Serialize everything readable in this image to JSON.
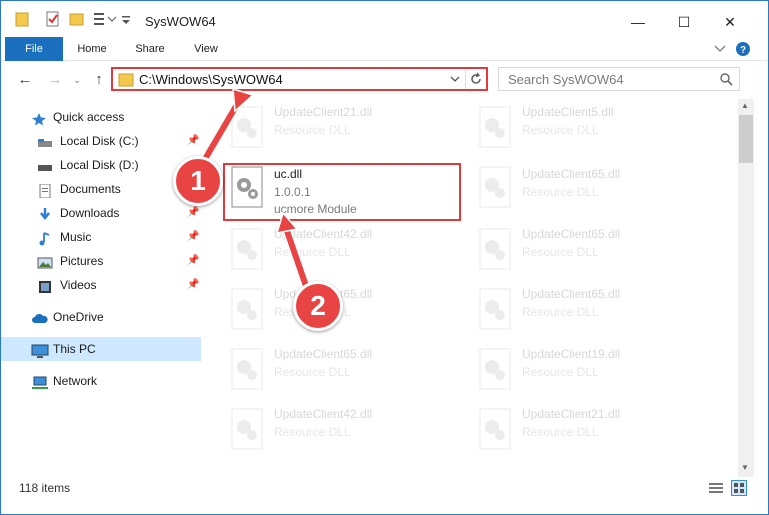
{
  "window": {
    "title": "SysWOW64",
    "minimize": "—",
    "maximize": "☐",
    "close": "✕"
  },
  "ribbon": {
    "tabs": [
      "File",
      "Home",
      "Share",
      "View"
    ]
  },
  "address": {
    "path": "C:\\Windows\\SysWOW64",
    "search_placeholder": "Search SysWOW64"
  },
  "nav": {
    "items": [
      {
        "label": "Quick access",
        "icon": "star-icon"
      },
      {
        "label": "Local Disk (C:)",
        "icon": "drive-icon",
        "pinned": true
      },
      {
        "label": "Local Disk (D:)",
        "icon": "drive-icon"
      },
      {
        "label": "Documents",
        "icon": "documents-icon",
        "pinned": true
      },
      {
        "label": "Downloads",
        "icon": "download-icon",
        "pinned": true
      },
      {
        "label": "Music",
        "icon": "music-icon",
        "pinned": true
      },
      {
        "label": "Pictures",
        "icon": "pictures-icon",
        "pinned": true
      },
      {
        "label": "Videos",
        "icon": "videos-icon",
        "pinned": true
      },
      {
        "label": "OneDrive",
        "icon": "cloud-icon"
      },
      {
        "label": "This PC",
        "icon": "monitor-icon",
        "selected": true
      },
      {
        "label": "Network",
        "icon": "network-icon"
      }
    ]
  },
  "files": [
    {
      "name": "UpdateClient21.dll",
      "type": "Resource DLL",
      "faded": true
    },
    {
      "name": "UpdateClient5.dll",
      "type": "Resource DLL",
      "faded": true
    },
    {
      "name": "uc.dll",
      "version": "1.0.0.1",
      "type": "ucmore Module",
      "faded": false
    },
    {
      "name": "UpdateClient65.dll",
      "type": "Resource DLL",
      "faded": true
    },
    {
      "name": "UpdateClient42.dll",
      "type": "Resource DLL",
      "faded": true
    },
    {
      "name": "UpdateClient65.dll",
      "type": "Resource DLL",
      "faded": true
    },
    {
      "name": "UpdateClient65.dll",
      "type": "Resource DLL",
      "faded": true
    },
    {
      "name": "UpdateClient65.dll",
      "type": "Resource DLL",
      "faded": true
    },
    {
      "name": "UpdateClient65.dll",
      "type": "Resource DLL",
      "faded": true
    },
    {
      "name": "UpdateClient19.dll",
      "type": "Resource DLL",
      "faded": true
    },
    {
      "name": "UpdateClient42.dll",
      "type": "Resource DLL",
      "faded": true
    },
    {
      "name": "UpdateClient21.dll",
      "type": "Resource DLL",
      "faded": true
    }
  ],
  "status": {
    "item_count": "118 items"
  },
  "annotations": {
    "step1": "1",
    "step2": "2",
    "accent_color": "#e03a3a"
  }
}
